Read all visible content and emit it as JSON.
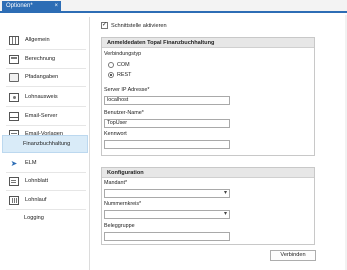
{
  "tab": {
    "title": "Optionen*",
    "close_glyph": "×"
  },
  "sidebar": {
    "items": [
      {
        "label": "Allgemein",
        "icon": "grid-icon"
      },
      {
        "label": "Berechnung",
        "icon": "calculator-icon"
      },
      {
        "label": "Pfadangaben",
        "icon": "folder-icon"
      },
      {
        "label": "Lohnausweis",
        "icon": "money-icon"
      },
      {
        "label": "Email-Server",
        "icon": "mail-icon"
      },
      {
        "label": "Email-Vorlagen",
        "icon": "mail-template-icon"
      },
      {
        "label": "Finanzbuchhaltung",
        "icon": "",
        "active": true
      },
      {
        "label": "ELM",
        "icon": "elm-icon"
      },
      {
        "label": "Lohnblatt",
        "icon": "sheet-icon"
      },
      {
        "label": "Lohnlauf",
        "icon": "run-icon"
      },
      {
        "label": "Logging",
        "icon": ""
      }
    ]
  },
  "main": {
    "interface_checkbox": {
      "label": "Schnittstelle aktivieren",
      "checked": true,
      "mark": "✓"
    },
    "login_group": {
      "title": "Anmeldedaten Topal Finanzbuchhaltung",
      "connection_label": "Verbindungstyp",
      "options": [
        {
          "label": "COM",
          "selected": false
        },
        {
          "label": "REST",
          "selected": true
        }
      ],
      "server_label": "Server IP Adresse*",
      "server_value": "localhost",
      "user_label": "Benutzer-Name*",
      "user_value": "TopUser",
      "password_label": "Kennwort",
      "password_value": ""
    },
    "config_group": {
      "title": "Konfiguration",
      "mandant_label": "Mandant*",
      "mandant_value": "",
      "nummernkreis_label": "Nummernkreis*",
      "nummernkreis_value": "",
      "beleggruppe_label": "Beleggruppe",
      "beleggruppe_value": ""
    },
    "connect_button": "Verbinden"
  }
}
